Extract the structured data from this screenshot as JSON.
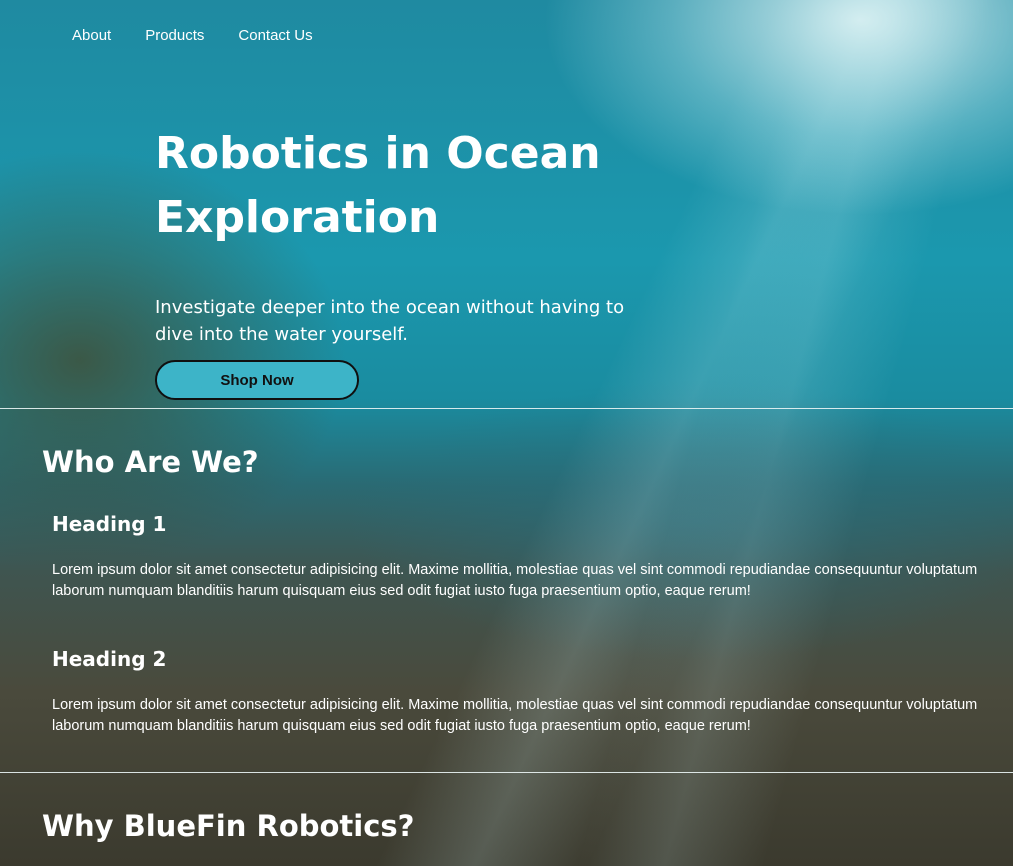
{
  "nav": {
    "items": [
      {
        "label": "About"
      },
      {
        "label": "Products"
      },
      {
        "label": "Contact Us"
      }
    ]
  },
  "hero": {
    "title_line1": "Robotics in Ocean",
    "title_line2": "Exploration",
    "subtitle": "Investigate deeper into the ocean without having to dive into the water yourself.",
    "button_label": "Shop Now"
  },
  "who": {
    "title": "Who Are We?",
    "items": [
      {
        "heading": "Heading 1",
        "body": "Lorem ipsum dolor sit amet consectetur adipisicing elit. Maxime mollitia, molestiae quas vel sint commodi repudiandae consequuntur voluptatum laborum numquam blanditiis harum quisquam eius sed odit fugiat iusto fuga praesentium optio, eaque rerum!"
      },
      {
        "heading": "Heading 2",
        "body": "Lorem ipsum dolor sit amet consectetur adipisicing elit. Maxime mollitia, molestiae quas vel sint commodi repudiandae consequuntur voluptatum laborum numquam blanditiis harum quisquam eius sed odit fugiat iusto fuga praesentium optio, eaque rerum!"
      }
    ]
  },
  "why": {
    "title": "Why BlueFin Robotics?"
  },
  "colors": {
    "button_bg": "#3db4c8",
    "text": "#ffffff",
    "water": "#1b98ae"
  }
}
